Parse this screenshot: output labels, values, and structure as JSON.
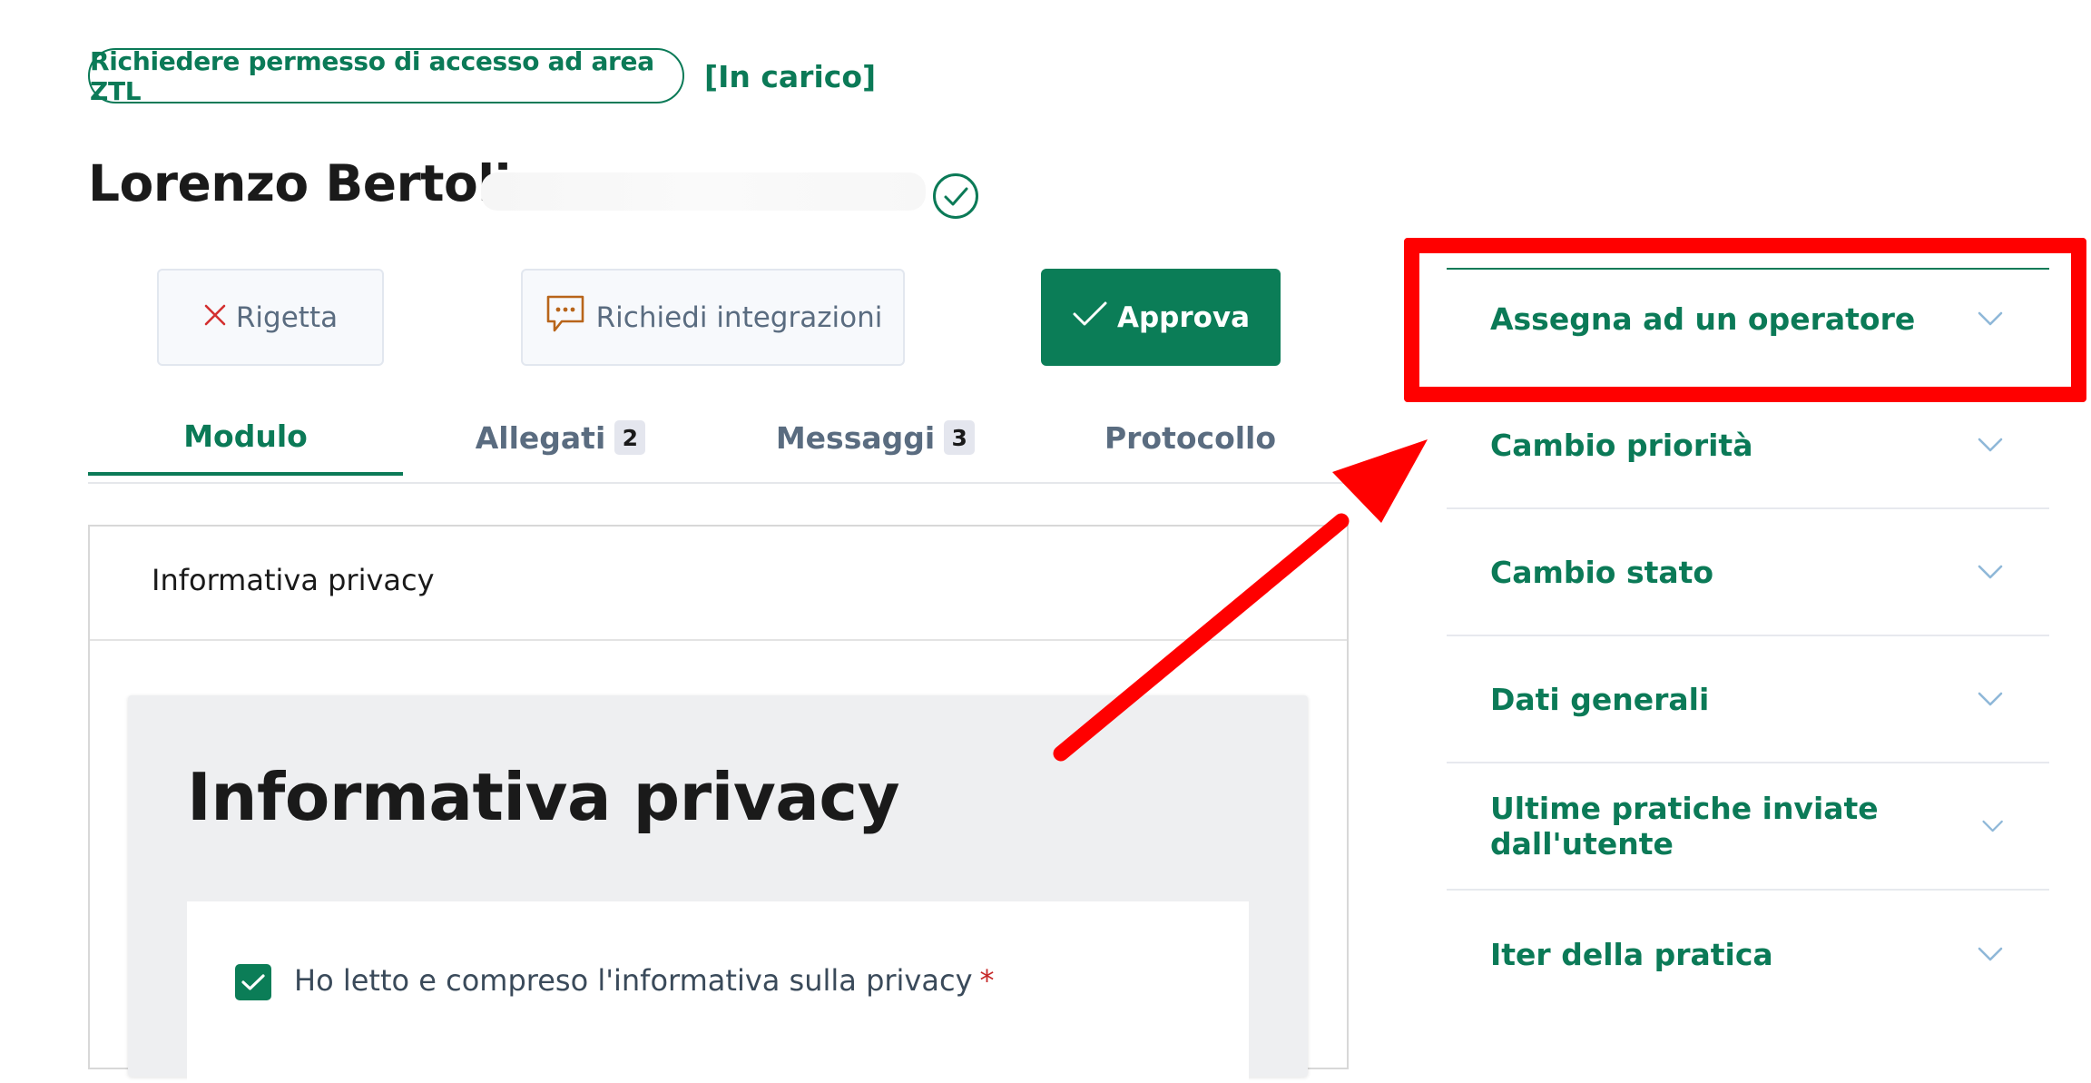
{
  "header": {
    "service_name": "Richiedere permesso di accesso ad area ZTL",
    "status": "[In carico]",
    "user_name": "Lorenzo Bertoli"
  },
  "actions": {
    "reject_label": "Rigetta",
    "request_integrations_label": "Richiedi integrazioni",
    "approve_label": "Approva"
  },
  "tabs": [
    {
      "label": "Modulo",
      "badge": null,
      "active": true
    },
    {
      "label": "Allegati",
      "badge": "2",
      "active": false
    },
    {
      "label": "Messaggi",
      "badge": "3",
      "active": false
    },
    {
      "label": "Protocollo",
      "badge": null,
      "active": false
    }
  ],
  "form": {
    "card_title": "Informativa privacy",
    "panel_heading": "Informativa privacy",
    "checkbox_label": "Ho letto e compreso l'informativa sulla privacy",
    "required_mark": "*",
    "checkbox_checked": true
  },
  "accordion": {
    "items": [
      {
        "label": "Assegna ad un operatore"
      },
      {
        "label": "Cambio priorità"
      },
      {
        "label": "Cambio stato"
      },
      {
        "label": "Dati generali"
      },
      {
        "label": "Ultime pratiche inviate dall'utente"
      },
      {
        "label": "Iter della pratica"
      }
    ]
  },
  "colors": {
    "brand_green": "#0b7a57",
    "annotation_red": "#ff0000",
    "reject_icon": "#d32f2f",
    "message_icon": "#b8651a",
    "chevron": "#8fb8d8"
  }
}
